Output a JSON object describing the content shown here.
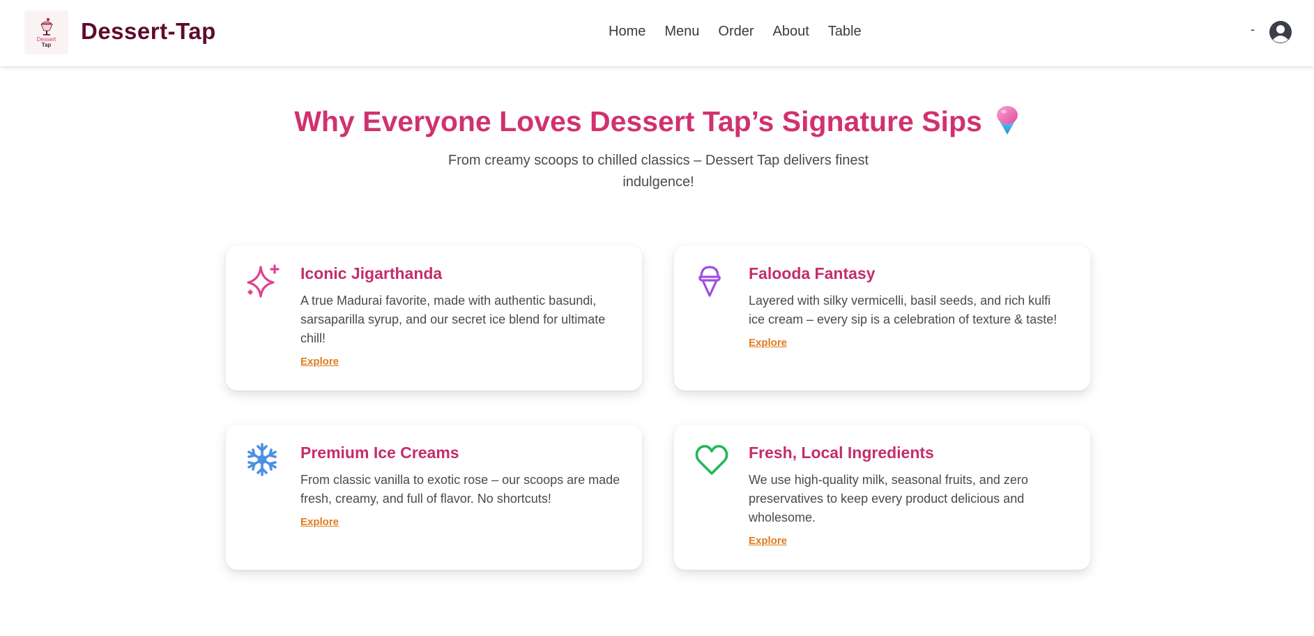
{
  "header": {
    "brand": "Dessert-Tap",
    "logo_text_top": "Dessert",
    "logo_text_bottom": "Tap",
    "nav": [
      "Home",
      "Menu",
      "Order",
      "About",
      "Table"
    ],
    "user_name": "-"
  },
  "hero": {
    "title": "Why Everyone Loves Dessert Tap’s Signature Sips",
    "subtitle": "From creamy scoops to chilled classics – Dessert Tap delivers finest indulgence!"
  },
  "cards": [
    {
      "icon": "sparkles-icon",
      "title": "Iconic Jigarthanda",
      "description": "A true Madurai favorite, made with authentic basundi, sarsaparilla syrup, and our secret ice blend for ultimate chill!",
      "link": "Explore"
    },
    {
      "icon": "ice-cream-icon",
      "title": "Falooda Fantasy",
      "description": "Layered with silky vermicelli, basil seeds, and rich kulfi ice cream – every sip is a celebration of texture & taste!",
      "link": "Explore"
    },
    {
      "icon": "snowflake-icon",
      "title": "Premium Ice Creams",
      "description": "From classic vanilla to exotic rose – our scoops are made fresh, creamy, and full of flavor. No shortcuts!",
      "link": "Explore"
    },
    {
      "icon": "heart-icon",
      "title": "Fresh, Local Ingredients",
      "description": "We use high-quality milk, seasonal fruits, and zero preservatives to keep every product delicious and wholesome.",
      "link": "Explore"
    }
  ],
  "colors": {
    "brand": "#5e0b2e",
    "accent": "#d1316f",
    "link": "#e07b1a",
    "sparkles": "#e0418a",
    "ice_cream": "#a04ee0",
    "snowflake": "#4a90e2",
    "heart": "#22b85a"
  }
}
